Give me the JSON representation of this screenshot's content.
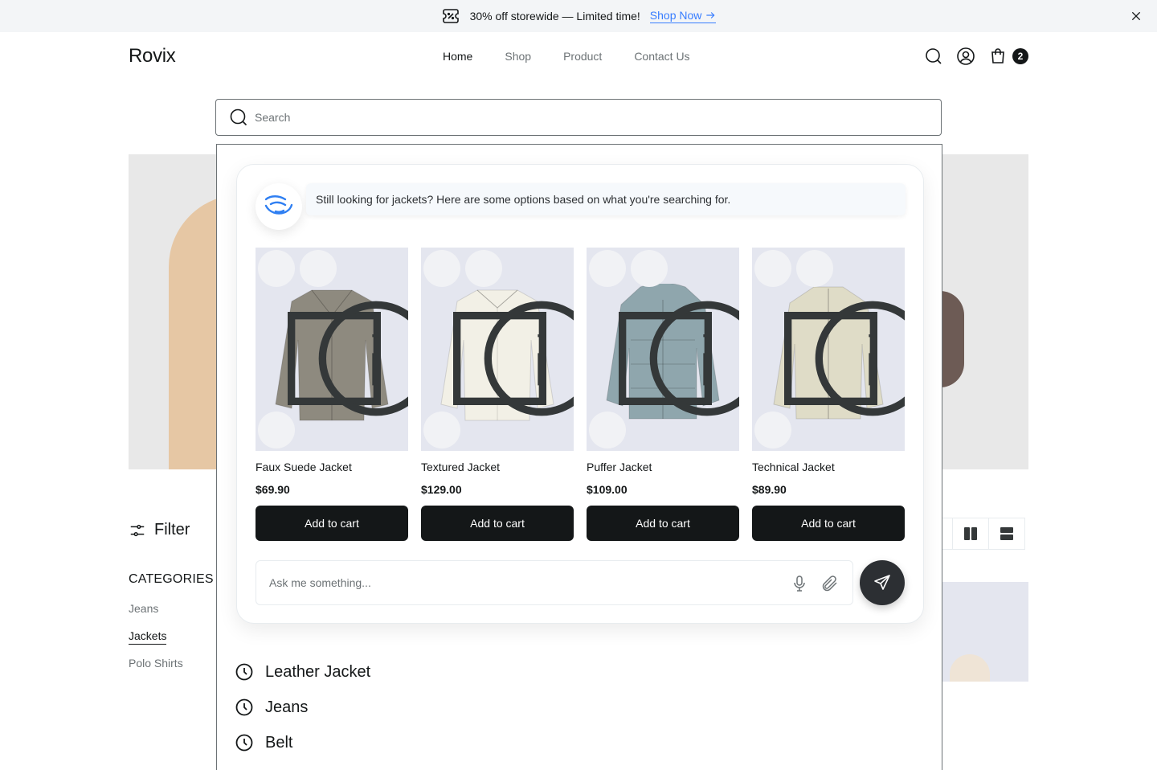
{
  "promo": {
    "text": "30% off storewide — Limited time!",
    "link": "Shop Now"
  },
  "header": {
    "logo": "Rovix",
    "nav": [
      "Home",
      "Shop",
      "Product",
      "Contact Us"
    ],
    "cart_count": "2"
  },
  "search": {
    "placeholder": "Search",
    "value": ""
  },
  "assistant": {
    "message": "Still looking for jackets? Here are some options based on what you're searching for.",
    "input_placeholder": "Ask me something...",
    "products": [
      {
        "name": "Faux Suede Jacket",
        "price": "$69.90",
        "button": "Add to cart",
        "color": "#8e8a7f"
      },
      {
        "name": "Textured Jacket",
        "price": "$129.00",
        "button": "Add to cart",
        "color": "#f2f0e6"
      },
      {
        "name": "Puffer Jacket",
        "price": "$109.00",
        "button": "Add to cart",
        "color": "#8fa6ad"
      },
      {
        "name": "Technical Jacket",
        "price": "$89.90",
        "button": "Add to cart",
        "color": "#dfdcc7"
      }
    ]
  },
  "recent_searches": [
    "Leather Jacket",
    "Jeans",
    "Belt"
  ],
  "sidebar": {
    "filter_label": "Filter",
    "categories_title": "CATEGORIES",
    "categories": [
      "Jeans",
      "Jackets",
      "Polo Shirts"
    ],
    "selected_category": "Jackets"
  },
  "icons": {
    "promo": "ticket-percent-icon",
    "close": "close-icon",
    "search": "search-icon",
    "account": "user-icon",
    "cart": "shopping-bag-icon",
    "checkbox": "checkbox-icon",
    "info": "info-icon",
    "refresh": "refresh-icon",
    "mic": "microphone-icon",
    "attach": "paperclip-icon",
    "send": "send-icon",
    "history": "clock-icon"
  },
  "colors": {
    "accent": "#377dff",
    "button": "#141718"
  }
}
